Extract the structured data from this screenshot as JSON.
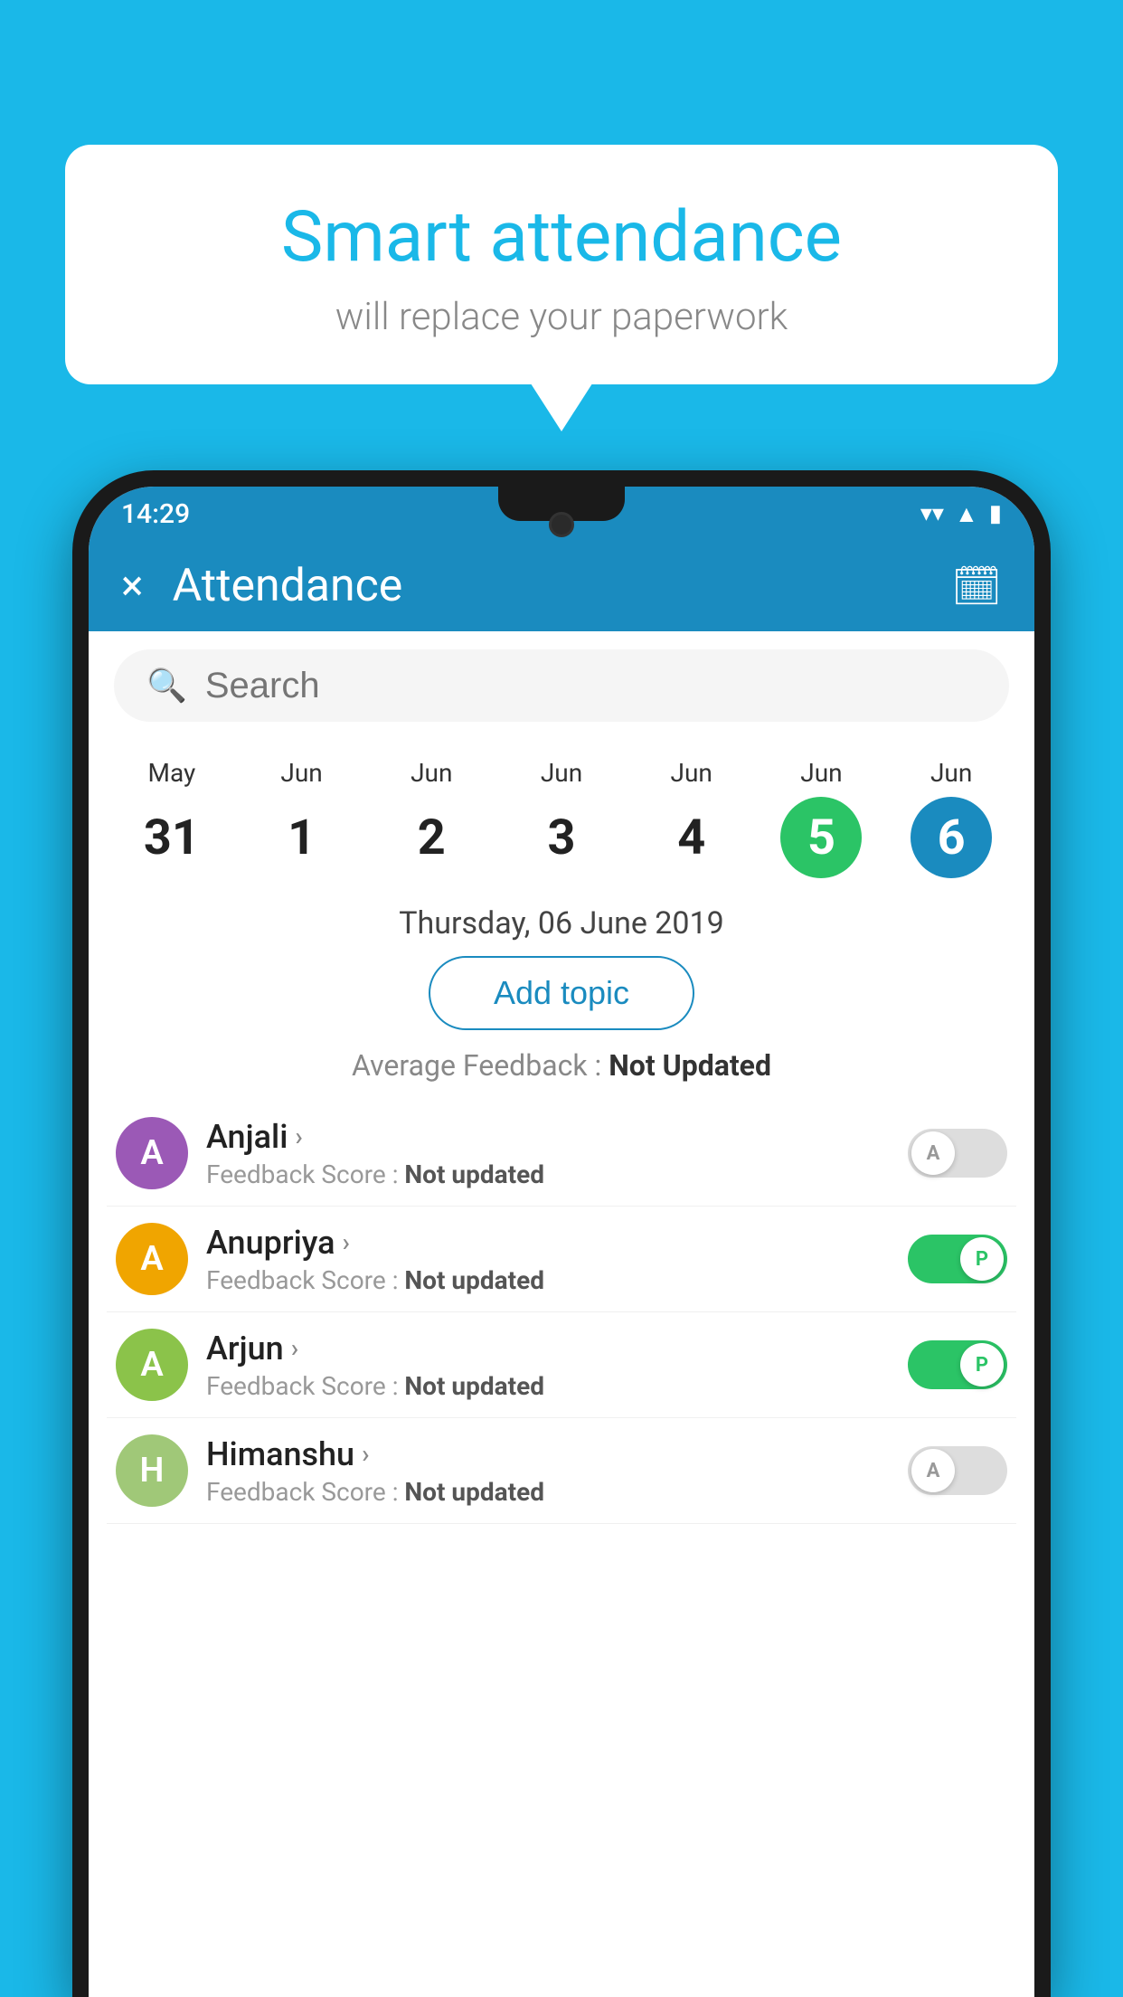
{
  "background": {
    "color": "#1ab8e8"
  },
  "bubble": {
    "title": "Smart attendance",
    "subtitle": "will replace your paperwork"
  },
  "status_bar": {
    "time": "14:29",
    "icons": [
      "wifi",
      "signal",
      "battery"
    ]
  },
  "app_bar": {
    "close_label": "×",
    "title": "Attendance",
    "calendar_icon": "📅"
  },
  "search": {
    "placeholder": "Search"
  },
  "dates": [
    {
      "month": "May",
      "day": "31",
      "style": "normal"
    },
    {
      "month": "Jun",
      "day": "1",
      "style": "normal"
    },
    {
      "month": "Jun",
      "day": "2",
      "style": "normal"
    },
    {
      "month": "Jun",
      "day": "3",
      "style": "normal"
    },
    {
      "month": "Jun",
      "day": "4",
      "style": "normal"
    },
    {
      "month": "Jun",
      "day": "5",
      "style": "today"
    },
    {
      "month": "Jun",
      "day": "6",
      "style": "selected"
    }
  ],
  "selected_date": "Thursday, 06 June 2019",
  "add_topic_label": "Add topic",
  "avg_feedback": {
    "label": "Average Feedback : ",
    "value": "Not Updated"
  },
  "students": [
    {
      "name": "Anjali",
      "initial": "A",
      "avatar_color": "#9b59b6",
      "feedback": "Not updated",
      "toggle": "off",
      "toggle_letter": "A"
    },
    {
      "name": "Anupriya",
      "initial": "A",
      "avatar_color": "#f0a500",
      "feedback": "Not updated",
      "toggle": "on",
      "toggle_letter": "P"
    },
    {
      "name": "Arjun",
      "initial": "A",
      "avatar_color": "#8bc34a",
      "feedback": "Not updated",
      "toggle": "on",
      "toggle_letter": "P"
    },
    {
      "name": "Himanshu",
      "initial": "H",
      "avatar_color": "#a0c878",
      "feedback": "Not updated",
      "toggle": "off",
      "toggle_letter": "A"
    }
  ]
}
